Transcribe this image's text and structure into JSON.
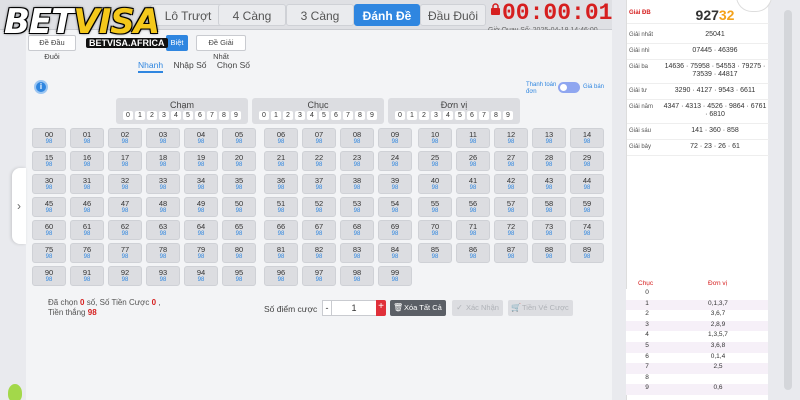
{
  "logo": {
    "brand_a": "BET",
    "brand_b": "VISA",
    "domain": "BETVISA.AFRICA"
  },
  "tabs": [
    {
      "label": "Lô Trượt",
      "active": false
    },
    {
      "label": "4 Càng",
      "active": false
    },
    {
      "label": "3 Càng",
      "active": false
    },
    {
      "label": "Đánh Đề",
      "active": true
    },
    {
      "label": "Đầu Đuôi",
      "active": false
    }
  ],
  "timer": {
    "countdown": "00:00:01",
    "draw_time": "Giờ Quay Số: 2025-04-18 14:46:00"
  },
  "subtabs": [
    {
      "label": "Đề Đầu Đuôi",
      "active": false
    },
    {
      "label": "Biệt",
      "active": true
    },
    {
      "label": "Đề Giải Nhất",
      "active": false
    }
  ],
  "modes": [
    {
      "label": "Nhanh",
      "active": true
    },
    {
      "label": "Nhập Số",
      "active": false
    },
    {
      "label": "Chọn Số",
      "active": false
    }
  ],
  "toggle": {
    "left_label": "Thanh toán đơn",
    "right_label": "Giá bán"
  },
  "digit_groups": [
    {
      "title": "Chạm",
      "digits": [
        "0",
        "1",
        "2",
        "3",
        "4",
        "5",
        "6",
        "7",
        "8",
        "9"
      ]
    },
    {
      "title": "Chục",
      "digits": [
        "0",
        "1",
        "2",
        "3",
        "4",
        "5",
        "6",
        "7",
        "8",
        "9"
      ]
    },
    {
      "title": "Đơn vị",
      "digits": [
        "0",
        "1",
        "2",
        "3",
        "4",
        "5",
        "6",
        "7",
        "8",
        "9"
      ]
    }
  ],
  "odds": "98",
  "summary": {
    "chosen_label": "Đã chọn",
    "chosen_count": "0",
    "chosen_unit": "số,",
    "bet_total_label": "Số Tiền Cược",
    "bet_total": "0",
    "win_label": "Tiền thắng",
    "win_value": "98"
  },
  "bet": {
    "label": "Số điểm cược",
    "value": "1",
    "minus": "-",
    "plus": "+"
  },
  "actions": {
    "clear": "Xóa Tất Cả",
    "confirm": "Xác Nhận",
    "add_bet": "Tiền Vé Cược"
  },
  "results": [
    {
      "prize": "Giải ĐB",
      "value": "92732",
      "special": true
    },
    {
      "prize": "Giải nhất",
      "value": "25041"
    },
    {
      "prize": "Giải nhì",
      "value": "07445 · 46396"
    },
    {
      "prize": "Giải ba",
      "value": "14636 · 75958 · 54553 · 79275 · 73539 · 44817"
    },
    {
      "prize": "Giải tư",
      "value": "3290 · 4127 · 9543 · 6611"
    },
    {
      "prize": "Giải năm",
      "value": "4347 · 4313 · 4526 · 9864 · 6761 · 6810"
    },
    {
      "prize": "Giải sáu",
      "value": "141 · 360 · 858"
    },
    {
      "prize": "Giải bảy",
      "value": "72 · 23 · 26 · 61"
    }
  ],
  "special_parts": {
    "main": "927",
    "highlight": "32"
  },
  "loto": {
    "head_chuc": "Chục",
    "head_donvi": "Đơn vị",
    "rows": [
      {
        "c": "0",
        "u": ""
      },
      {
        "c": "1",
        "u": "0,1,3,7"
      },
      {
        "c": "2",
        "u": "3,6,7"
      },
      {
        "c": "3",
        "u": "2,8,9"
      },
      {
        "c": "4",
        "u": "1,3,5,7"
      },
      {
        "c": "5",
        "u": "3,6,8"
      },
      {
        "c": "6",
        "u": "0,1,4"
      },
      {
        "c": "7",
        "u": "2,5"
      },
      {
        "c": "8",
        "u": ""
      },
      {
        "c": "9",
        "u": "0,6"
      }
    ]
  },
  "colors": {
    "accent": "#2f86e0",
    "timer": "#d61f1f",
    "plus": "#e0303a",
    "logo_yellow": "#f4c81b"
  }
}
